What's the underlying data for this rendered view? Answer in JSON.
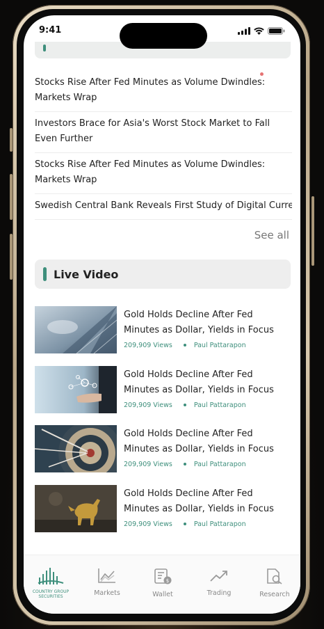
{
  "status_bar": {
    "time": "9:41"
  },
  "news": {
    "items": [
      "Stocks Rise After Fed Minutes as Volume Dwindles: Markets Wrap",
      "Investors Brace for Asia's Worst Stock Market to Fall Even Further",
      "Stocks Rise After Fed Minutes as Volume Dwindles: Markets Wrap",
      "Swedish Central Bank Reveals First Study of Digital Currency"
    ],
    "see_all": "See all"
  },
  "live_video": {
    "title": "Live Video",
    "items": [
      {
        "title": "Gold Holds Decline After Fed Minutes as Dollar, Yields in Focus",
        "views": "209,909 Views",
        "author": "Paul Pattarapon",
        "thumb": "glass-building"
      },
      {
        "title": "Gold Holds Decline After Fed Minutes as Dollar, Yields in Focus",
        "views": "209,909 Views",
        "author": "Paul Pattarapon",
        "thumb": "businessman-hand"
      },
      {
        "title": "Gold Holds Decline After Fed Minutes as Dollar, Yields in Focus",
        "views": "209,909 Views",
        "author": "Paul Pattarapon",
        "thumb": "dartboard"
      },
      {
        "title": "Gold Holds Decline After Fed Minutes as Dollar, Yields in Focus",
        "views": "209,909 Views",
        "author": "Paul Pattarapon",
        "thumb": "golden-bull"
      }
    ]
  },
  "tabbar": {
    "home": {
      "brand_line1": "COUNTRY GROUP",
      "brand_line2": "SECURITIES"
    },
    "markets": "Markets",
    "wallet": "Wallet",
    "trading": "Trading",
    "research": "Research"
  },
  "colors": {
    "accent": "#3e8f7c",
    "header_bg": "#eeeeee"
  }
}
